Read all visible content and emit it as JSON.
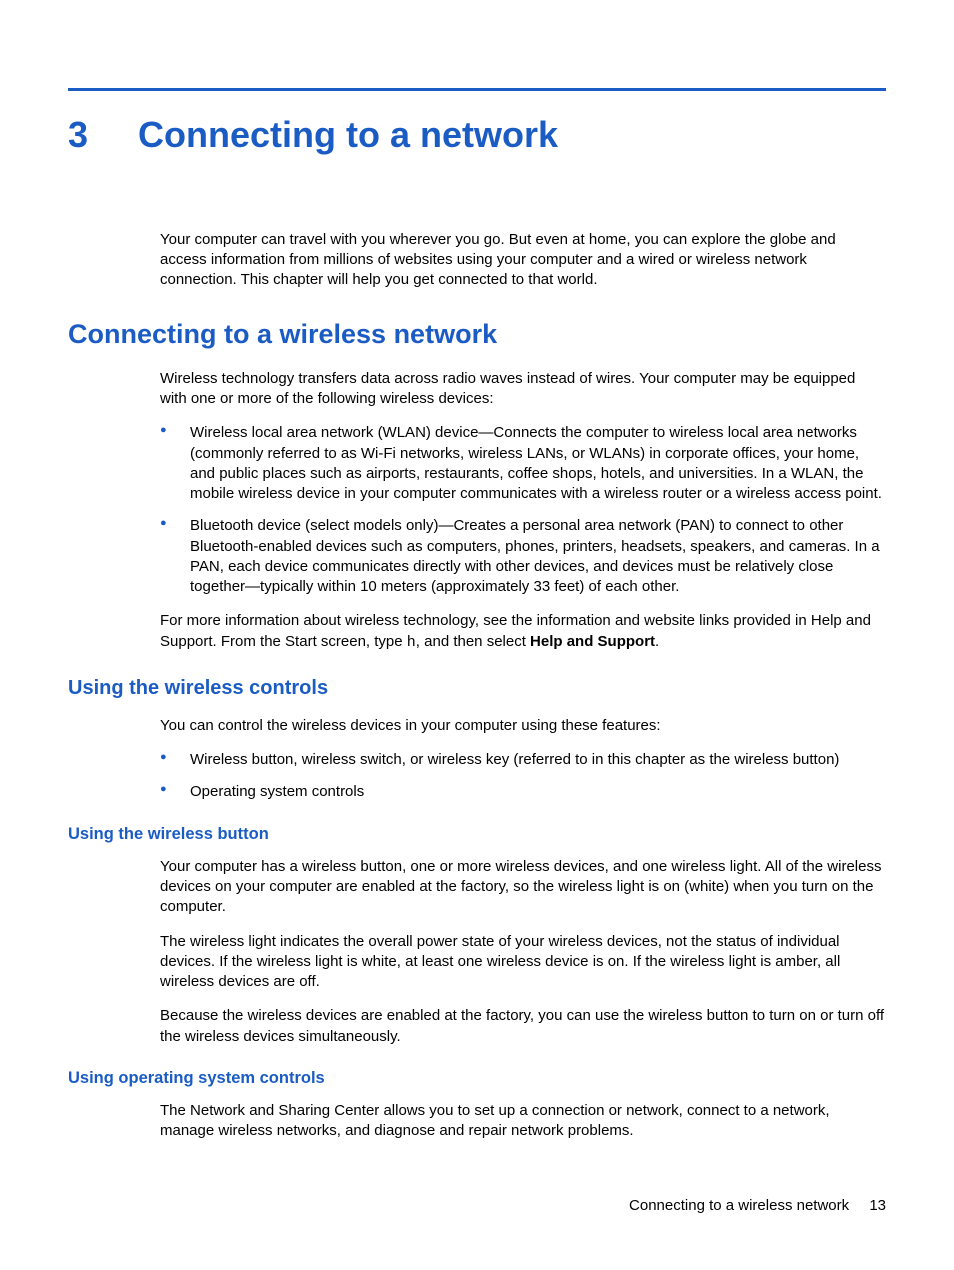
{
  "chapter": {
    "number": "3",
    "title": "Connecting to a network",
    "intro": "Your computer can travel with you wherever you go. But even at home, you can explore the globe and access information from millions of websites using your computer and a wired or wireless network connection. This chapter will help you get connected to that world."
  },
  "section1": {
    "title": "Connecting to a wireless network",
    "intro": "Wireless technology transfers data across radio waves instead of wires. Your computer may be equipped with one or more of the following wireless devices:",
    "bullets": [
      "Wireless local area network (WLAN) device—Connects the computer to wireless local area networks (commonly referred to as Wi-Fi networks, wireless LANs, or WLANs) in corporate offices, your home, and public places such as airports, restaurants, coffee shops, hotels, and universities. In a WLAN, the mobile wireless device in your computer communicates with a wireless router or a wireless access point.",
      "Bluetooth device (select models only)—Creates a personal area network (PAN) to connect to other Bluetooth-enabled devices such as computers, phones, printers, headsets, speakers, and cameras. In a PAN, each device communicates directly with other devices, and devices must be relatively close together—typically within 10 meters (approximately 33 feet) of each other."
    ],
    "more_prefix": "For more information about wireless technology, see the information and website links provided in Help and Support. From the Start screen, type ",
    "more_key": "h",
    "more_mid": ", and then select ",
    "more_bold": "Help and Support",
    "more_suffix": "."
  },
  "section2": {
    "title": "Using the wireless controls",
    "intro": "You can control the wireless devices in your computer using these features:",
    "bullets": [
      "Wireless button, wireless switch, or wireless key (referred to in this chapter as the wireless button)",
      "Operating system controls"
    ]
  },
  "section3": {
    "title": "Using the wireless button",
    "paras": [
      "Your computer has a wireless button, one or more wireless devices, and one wireless light. All of the wireless devices on your computer are enabled at the factory, so the wireless light is on (white) when you turn on the computer.",
      "The wireless light indicates the overall power state of your wireless devices, not the status of individual devices. If the wireless light is white, at least one wireless device is on. If the wireless light is amber, all wireless devices are off.",
      "Because the wireless devices are enabled at the factory, you can use the wireless button to turn on or turn off the wireless devices simultaneously."
    ]
  },
  "section4": {
    "title": "Using operating system controls",
    "para": "The Network and Sharing Center allows you to set up a connection or network, connect to a network, manage wireless networks, and diagnose and repair network problems."
  },
  "footer": {
    "label": "Connecting to a wireless network",
    "page": "13"
  }
}
